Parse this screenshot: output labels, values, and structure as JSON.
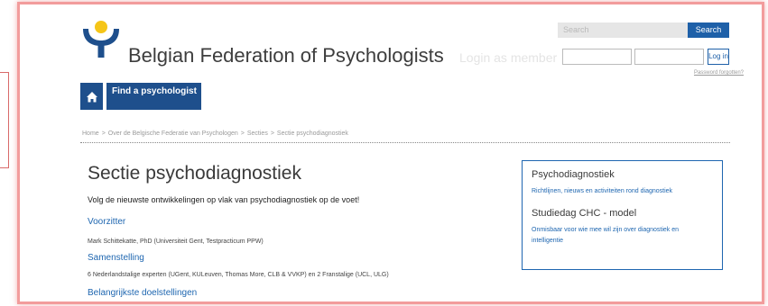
{
  "header": {
    "site_title": "Belgian Federation of Psychologists",
    "search_placeholder": "Search",
    "search_button": "Search",
    "login_label": "Login as member",
    "login_button": "Log in",
    "password_forgotten": "Password forgotten?"
  },
  "nav": {
    "home_icon": "home-icon",
    "find_button": "Find a psychologist"
  },
  "breadcrumb": [
    "Home",
    "Over de Belgische Federatie van Psychologen",
    "Secties",
    "Sectie psychodiagnostiek"
  ],
  "breadcrumb_separator": ">",
  "main": {
    "title": "Sectie psychodiagnostiek",
    "intro": "Volg de nieuwste ontwikkelingen op vlak van psychodiagnostiek op de voet!",
    "chair_heading": "Voorzitter",
    "chair_text": "Mark Schittekatte, PhD (Universiteit Gent, Testpracticum PPW)",
    "composition_heading": "Samenstelling",
    "composition_text": "6 Nederlandstalige experten (UGent, KULeuven, Thomas More, CLB & VVKP) en 2 Franstalige (UCL, ULG)",
    "goals_heading": "Belangrijkste doelstellingen"
  },
  "sidebar": {
    "item1_title": "Psychodiagnostiek",
    "item1_text": "Richtlijnen, nieuws en activiteiten rond diagnostiek",
    "item2_title": "Studiedag CHC - model",
    "item2_text_line1": "Onmisbaar voor wie mee wil zijn over diagnostiek en",
    "item2_text_line2": "intelligentie"
  },
  "colors": {
    "brand_blue": "#1e4f8c",
    "link_blue": "#1e66b0",
    "logo_yellow": "#f5c518",
    "frame_red": "#f29c9c"
  }
}
